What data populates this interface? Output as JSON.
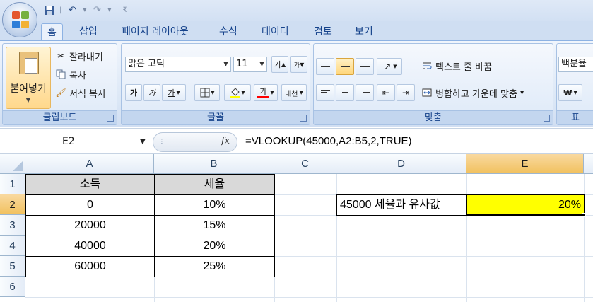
{
  "qat": {
    "icons": [
      "save-icon",
      "undo-icon",
      "redo-icon"
    ]
  },
  "tabs": [
    "홈",
    "삽입",
    "페이지 레이아웃",
    "수식",
    "데이터",
    "검토",
    "보기"
  ],
  "ribbon": {
    "clipboard": {
      "label": "클립보드",
      "paste": "붙여넣기",
      "cut": "잘라내기",
      "copy": "복사",
      "format_painter": "서식 복사"
    },
    "font": {
      "label": "글꼴",
      "font_name": "맑은 고딕",
      "font_size": "11",
      "grow": "가",
      "shrink": "가",
      "bold": "가",
      "italic": "가",
      "underline": "가",
      "font_color": "가",
      "phonetic": "내천",
      "font_color_hex": "#ff0000",
      "highlight_hex": "#ffff00"
    },
    "alignment": {
      "label": "맞춤",
      "wrap_text": "텍스트 줄 바꿈",
      "merge_center": "병합하고 가운데 맞춤"
    },
    "number": {
      "label": "표",
      "format": "백분율",
      "currency": "₩"
    }
  },
  "formula_bar": {
    "name_box": "E2",
    "fx": "fx",
    "formula": "=VLOOKUP(45000,A2:B5,2,TRUE)"
  },
  "grid": {
    "columns": [
      "A",
      "B",
      "C",
      "D",
      "E"
    ],
    "rows": [
      "1",
      "2",
      "3",
      "4",
      "5",
      "6"
    ],
    "header": {
      "a1": "소득",
      "b1": "세율"
    },
    "table": [
      {
        "income": "0",
        "rate": "10%"
      },
      {
        "income": "20000",
        "rate": "15%"
      },
      {
        "income": "40000",
        "rate": "20%"
      },
      {
        "income": "60000",
        "rate": "25%"
      }
    ],
    "d2": "45000 세율과 유사값",
    "e2": "20%",
    "selected_fill": "#ffff00"
  }
}
